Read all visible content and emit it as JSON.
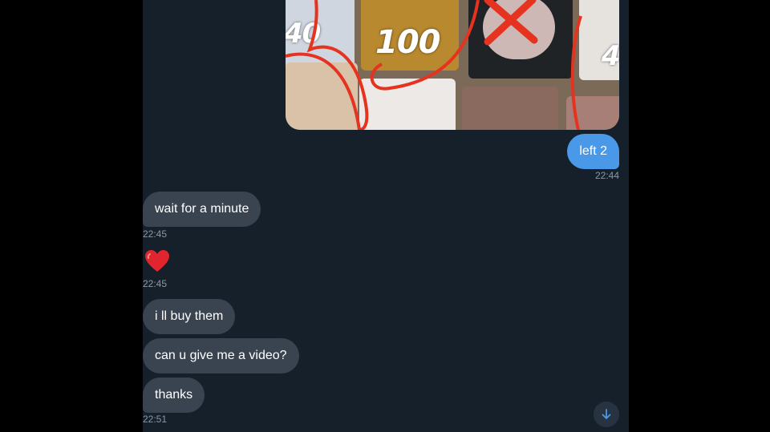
{
  "photo": {
    "numbers": [
      "40",
      "100",
      "4"
    ]
  },
  "messages": [
    {
      "id": "out1",
      "text": "left 2",
      "time": "22:44"
    },
    {
      "id": "in1",
      "text": "wait for a minute",
      "time": "22:45"
    },
    {
      "id": "in2",
      "emoji": "red-heart",
      "time": "22:45"
    },
    {
      "id": "in3",
      "text": "i ll buy them"
    },
    {
      "id": "in4",
      "text": "can u give me a video?"
    },
    {
      "id": "in5",
      "text": "thanks",
      "time": "22:51"
    }
  ],
  "colors": {
    "background": "#15202b",
    "incoming_bubble": "#3a4451",
    "outgoing_bubble": "#4a99e9",
    "timestamp": "#8b98a5"
  },
  "icons": {
    "scroll_down": "arrow-down-icon"
  }
}
